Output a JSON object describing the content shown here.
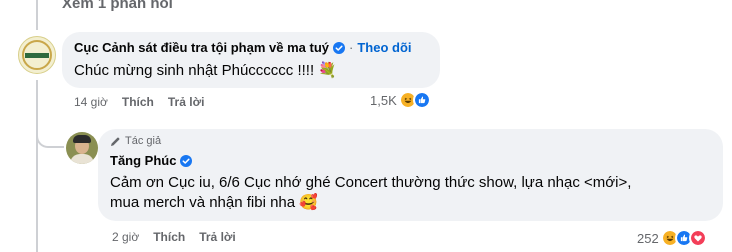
{
  "view_replies": "Xem 1 phản hồi",
  "comment": {
    "author": "Cục Cảnh sát điều tra tội phạm về ma tuý",
    "separator": "·",
    "follow_label": "Theo dõi",
    "text": "Chúc mừng sinh nhật Phúcccccc !!!! 💐",
    "time": "14 giờ",
    "like_label": "Thích",
    "reply_label": "Trả lời",
    "reaction_count": "1,5K",
    "reactions": [
      "haha-icon",
      "like-icon"
    ]
  },
  "reply": {
    "author_tag": "Tác giả",
    "author": "Tăng Phúc",
    "text_line1": "Cảm ơn Cục iu, 6/6 Cục nhớ ghé Concert thường thức show, lựa nhạc <mới>,",
    "text_line2": "mua merch và nhận fibi nha 🥰",
    "time": "2 giờ",
    "like_label": "Thích",
    "reply_label": "Trả lời",
    "reaction_count": "252",
    "reactions": [
      "haha-icon",
      "like-icon",
      "love-icon"
    ]
  },
  "colors": {
    "bubble": "#f0f2f5",
    "link": "#0064d1",
    "muted": "#65676b",
    "like": "#1877f2",
    "haha": "#f7b125",
    "love": "#f33e58"
  }
}
